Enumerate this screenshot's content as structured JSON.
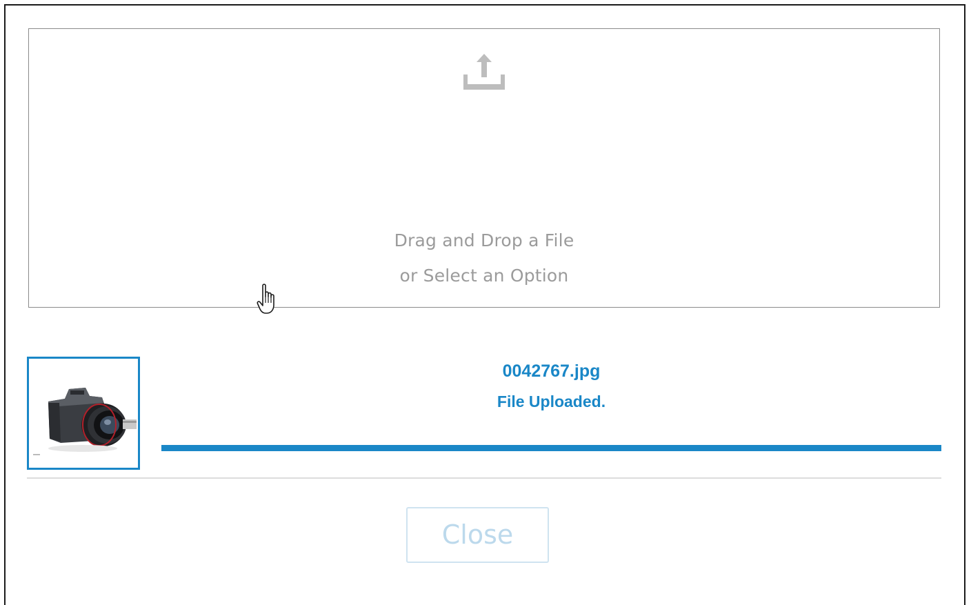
{
  "dropzone": {
    "icon": "upload-icon",
    "line1": "Drag and Drop a File",
    "line2": "or Select an Option"
  },
  "upload": {
    "thumbnail_icon": "camera-thumbnail",
    "file_name": "0042767.jpg",
    "status": "File Uploaded.",
    "progress_percent": 100
  },
  "footer": {
    "close_label": "Close"
  },
  "colors": {
    "accent": "#1a87c7",
    "muted_text": "#9b9b9b",
    "disabled_button_text": "#bcd9ec"
  }
}
